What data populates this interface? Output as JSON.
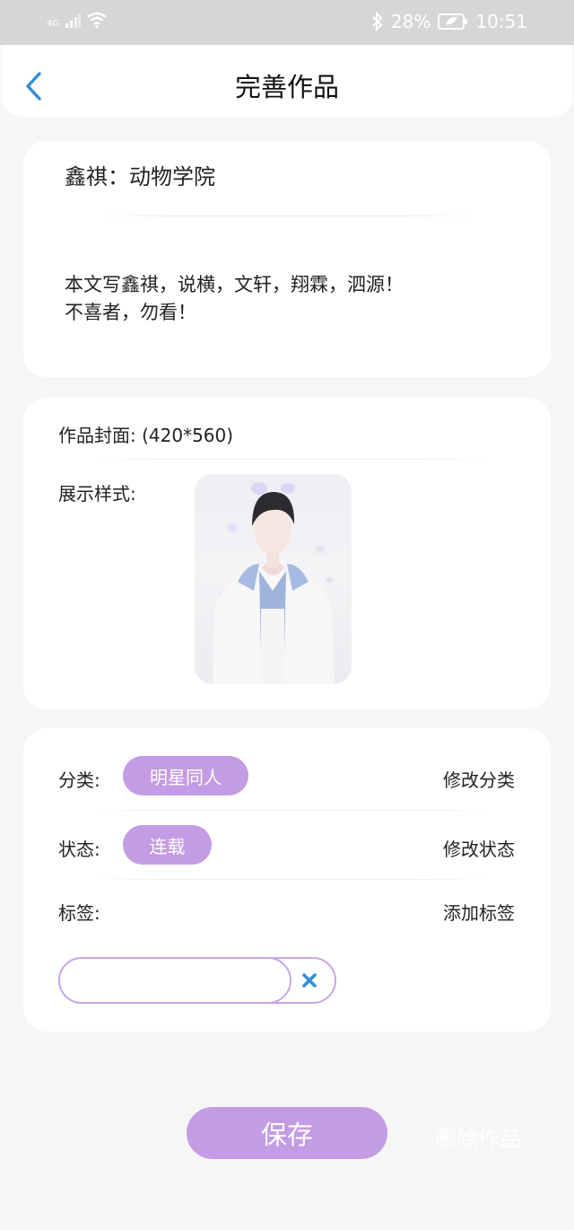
{
  "status_bar": {
    "network": "4G",
    "battery": "28%",
    "time": "10:51"
  },
  "header": {
    "title": "完善作品"
  },
  "work": {
    "title": "鑫祺：动物学院",
    "summary_lines": [
      "本文写鑫祺，说横，文轩，翔霖，泗源！",
      "不喜者，勿看！"
    ]
  },
  "cover": {
    "label": "作品封面: (420*560)",
    "preview_label": "展示样式:"
  },
  "meta": {
    "category_label": "分类:",
    "category_value": "明星同人",
    "category_action": "修改分类",
    "status_label": "状态:",
    "status_value": "连载",
    "status_action": "修改状态",
    "tags_label": "标签:",
    "tags_action": "添加标签",
    "tag_input_value": ""
  },
  "actions": {
    "save_label": "保存",
    "delete_label": "删除作品"
  },
  "colors": {
    "accent": "#c49ce4",
    "back_arrow": "#2f8fd8",
    "clear_icon": "#2f8fd8"
  }
}
